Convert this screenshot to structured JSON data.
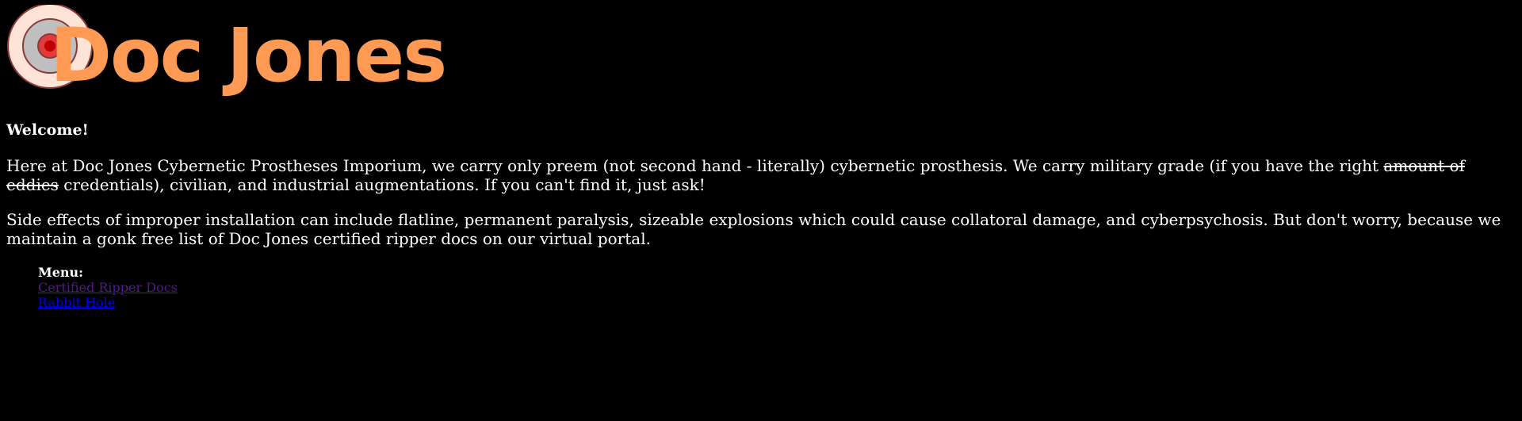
{
  "header": {
    "logo_text": "Doc Jones"
  },
  "main": {
    "welcome": "Welcome!",
    "intro_part1": "Here at Doc Jones Cybernetic Prostheses Imporium, we carry only preem (not second hand - literally) cybernetic prosthesis. We carry military grade (if you have the right ",
    "intro_struck": "amount of eddies",
    "intro_part2": " credentials), civilian, and industrial augmentations. If you can't find it, just ask!",
    "side_effects": "Side effects of improper installation can include flatline, permanent paralysis, sizeable explosions which could cause collatoral damage, and cyberpsychosis. But don't worry, because we maintain a gonk free list of Doc Jones certified ripper docs on our virtual portal."
  },
  "menu": {
    "title": "Menu:",
    "items": [
      {
        "label": "Certified Ripper Docs",
        "state": "visited"
      },
      {
        "label": "Rabbit Hole",
        "state": "unvisited"
      }
    ]
  },
  "colors": {
    "background": "#000000",
    "text": "#ffffff",
    "logo_orange": "#ff9a55",
    "link_visited": "#551a8b",
    "link_unvisited": "#0000ee"
  }
}
